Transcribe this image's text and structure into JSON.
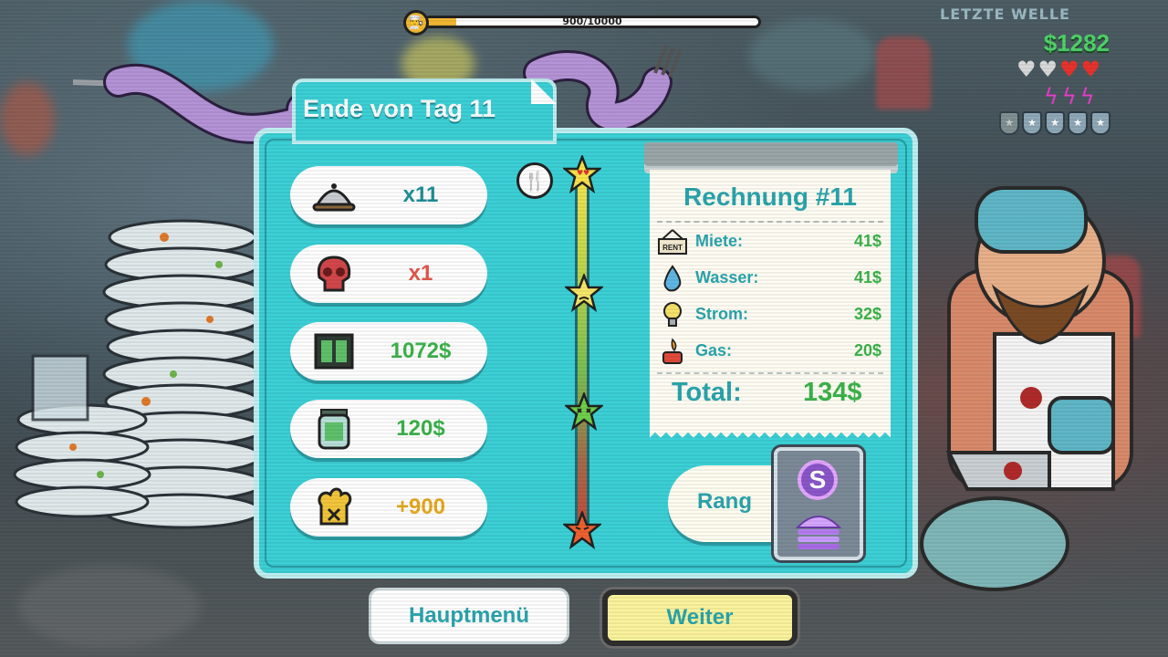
{
  "hud": {
    "xp_text": "900/10000",
    "xp_fraction": 0.09,
    "money": "$1282",
    "hearts": [
      "♥",
      "♥",
      "♥",
      "♥"
    ],
    "hearts_filled": 2,
    "bolts": [
      "ϟ",
      "ϟ",
      "ϟ"
    ],
    "badges": [
      "★",
      "★",
      "★",
      "★",
      "★"
    ],
    "badges_filled": 4,
    "wave_text": "LETZTE WELLE"
  },
  "summary": {
    "title": "Ende von Tag 11",
    "stats": [
      {
        "icon": "cloche-icon",
        "value": "x11",
        "color": "#1f8f96"
      },
      {
        "icon": "skull-icon",
        "value": "x1",
        "color": "#e2574c"
      },
      {
        "icon": "cash-register-icon",
        "value": "1072$",
        "color": "#3bb34a"
      },
      {
        "icon": "tip-jar-icon",
        "value": "120$",
        "color": "#3bb34a"
      },
      {
        "icon": "chef-hat-icon",
        "value": "+900",
        "color": "#e6a91e"
      }
    ]
  },
  "rating": {
    "stars": [
      "love-star-icon",
      "worried-star-icon",
      "dead-star-icon",
      "angry-star-icon"
    ]
  },
  "receipt": {
    "title": "Rechnung #11",
    "items": [
      {
        "icon": "rent-sign-icon",
        "label": "Miete:",
        "value": "41$",
        "sign_text": "RENT"
      },
      {
        "icon": "water-drop-icon",
        "label": "Wasser:",
        "value": "41$"
      },
      {
        "icon": "lightbulb-icon",
        "label": "Strom:",
        "value": "32$"
      },
      {
        "icon": "gas-burner-icon",
        "label": "Gas:",
        "value": "20$"
      }
    ],
    "total_label": "Total:",
    "total_value": "134$"
  },
  "rank": {
    "label": "Rang",
    "letter": "S"
  },
  "buttons": {
    "main_menu": "Hauptmenü",
    "continue": "Weiter"
  },
  "colors": {
    "panel": "#3bd0d6",
    "accent_text": "#2aa5ad",
    "money_green": "#3bb34a",
    "continue_bg": "#fbf39c"
  }
}
